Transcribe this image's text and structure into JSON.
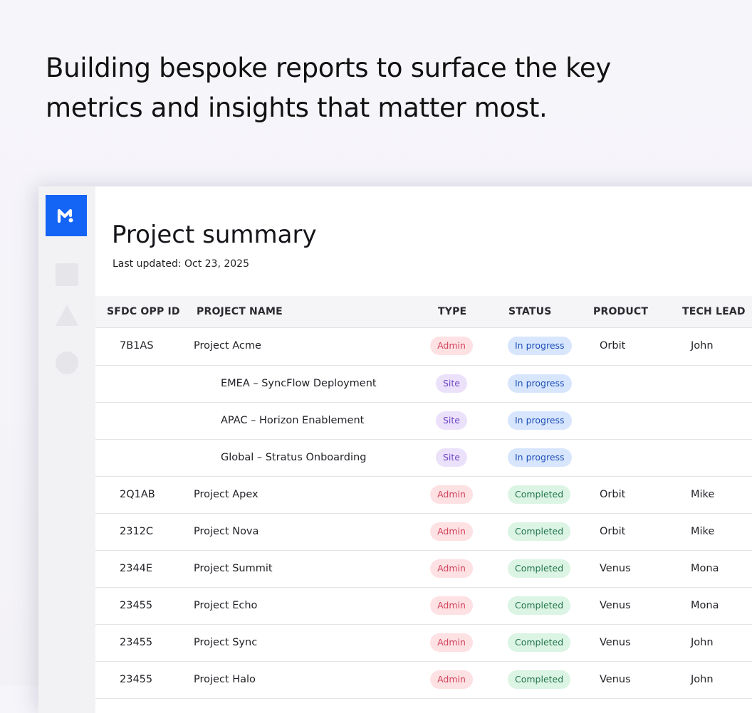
{
  "hero": {
    "text": "Building bespoke reports to surface the key metrics and insights that matter most."
  },
  "page": {
    "title": "Project summary",
    "last_updated": "Last updated: Oct 23, 2025"
  },
  "table": {
    "columns": [
      "SFDC OPP ID",
      "PROJECT NAME",
      "TYPE",
      "STATUS",
      "PRODUCT",
      "TECH LEAD"
    ],
    "rows": [
      {
        "id": "7B1AS",
        "name": "Project Acme",
        "type": "Admin",
        "status": "In progress",
        "product": "Orbit",
        "lead": "John",
        "sub": false
      },
      {
        "id": "",
        "name": "EMEA – SyncFlow Deployment",
        "type": "Site",
        "status": "In progress",
        "product": "",
        "lead": "",
        "sub": true
      },
      {
        "id": "",
        "name": "APAC – Horizon Enablement",
        "type": "Site",
        "status": "In progress",
        "product": "",
        "lead": "",
        "sub": true
      },
      {
        "id": "",
        "name": "Global – Stratus Onboarding",
        "type": "Site",
        "status": "In progress",
        "product": "",
        "lead": "",
        "sub": true
      },
      {
        "id": "2Q1AB",
        "name": "Project Apex",
        "type": "Admin",
        "status": "Completed",
        "product": "Orbit",
        "lead": "Mike",
        "sub": false
      },
      {
        "id": "2312C",
        "name": "Project Nova",
        "type": "Admin",
        "status": "Completed",
        "product": "Orbit",
        "lead": "Mike",
        "sub": false
      },
      {
        "id": "2344E",
        "name": "Project Summit",
        "type": "Admin",
        "status": "Completed",
        "product": "Venus",
        "lead": "Mona",
        "sub": false
      },
      {
        "id": "23455",
        "name": "Project Echo",
        "type": "Admin",
        "status": "Completed",
        "product": "Venus",
        "lead": "Mona",
        "sub": false
      },
      {
        "id": "23455",
        "name": "Project Sync",
        "type": "Admin",
        "status": "Completed",
        "product": "Venus",
        "lead": "John",
        "sub": false
      },
      {
        "id": "23455",
        "name": "Project Halo",
        "type": "Admin",
        "status": "Completed",
        "product": "Venus",
        "lead": "John",
        "sub": false
      }
    ]
  },
  "colors": {
    "brand": "#1464f6",
    "admin_pill": "#fde1e3",
    "site_pill": "#ece1fb",
    "in_progress_pill": "#d8e6fd",
    "completed_pill": "#dbf4e4"
  },
  "icons": {
    "logo": "m-logo-icon",
    "rail": [
      "square-icon",
      "triangle-icon",
      "circle-icon"
    ]
  }
}
